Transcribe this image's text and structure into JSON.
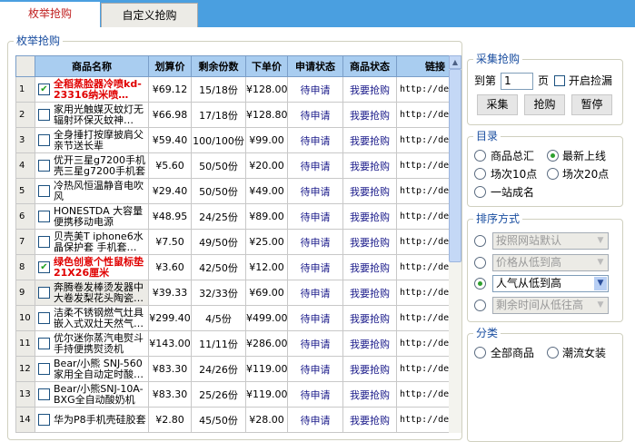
{
  "tabs": [
    {
      "label": "枚举抢购",
      "active": true
    },
    {
      "label": "自定义抢购",
      "active": false
    }
  ],
  "main_group": "枚举抢购",
  "table": {
    "headers": [
      "商品名称",
      "划算价",
      "剩余份数",
      "下单价",
      "申请状态",
      "商品状态",
      "链接"
    ],
    "rows": [
      {
        "n": "1",
        "checked": true,
        "red": true,
        "name": "全稻蒸脸器冷喷kd-23316纳米喷…",
        "price": "¥69.12",
        "remain": "15/18份",
        "order": "¥128.00",
        "apply": "待申请",
        "status": "我要抢购",
        "link": "http://de"
      },
      {
        "n": "2",
        "checked": false,
        "red": false,
        "name": "家用光触媒灭蚊灯无辐射环保灭蚊神…",
        "price": "¥66.98",
        "remain": "17/18份",
        "order": "¥128.80",
        "apply": "待申请",
        "status": "我要抢购",
        "link": "http://de"
      },
      {
        "n": "3",
        "checked": false,
        "red": false,
        "name": "全身捶打按摩披肩父亲节送长辈",
        "price": "¥59.40",
        "remain": "100/100份",
        "order": "¥99.00",
        "apply": "待申请",
        "status": "我要抢购",
        "link": "http://de"
      },
      {
        "n": "4",
        "checked": false,
        "red": false,
        "name": "优开三星g7200手机壳三星g7200手机套",
        "price": "¥5.60",
        "remain": "50/50份",
        "order": "¥20.00",
        "apply": "待申请",
        "status": "我要抢购",
        "link": "http://de"
      },
      {
        "n": "5",
        "checked": false,
        "red": false,
        "name": "冷热风恒温静音电吹风",
        "price": "¥29.40",
        "remain": "50/50份",
        "order": "¥49.00",
        "apply": "待申请",
        "status": "我要抢购",
        "link": "http://de"
      },
      {
        "n": "6",
        "checked": false,
        "red": false,
        "name": "HONESTDA 大容量便携移动电源",
        "price": "¥48.95",
        "remain": "24/25份",
        "order": "¥89.00",
        "apply": "待申请",
        "status": "我要抢购",
        "link": "http://de"
      },
      {
        "n": "7",
        "checked": false,
        "red": false,
        "name": "贝壳美T iphone6水晶保护套 手机套…",
        "price": "¥7.50",
        "remain": "49/50份",
        "order": "¥25.00",
        "apply": "待申请",
        "status": "我要抢购",
        "link": "http://de"
      },
      {
        "n": "8",
        "checked": true,
        "red": true,
        "name": "绿色创意个性鼠标垫21X26厘米",
        "price": "¥3.60",
        "remain": "42/50份",
        "order": "¥12.00",
        "apply": "待申请",
        "status": "我要抢购",
        "link": "http://de"
      },
      {
        "n": "9",
        "checked": false,
        "red": false,
        "name": "奔腾卷发棒烫发器中大卷发梨花头陶瓷…",
        "price": "¥39.33",
        "remain": "32/33份",
        "order": "¥69.00",
        "apply": "待申请",
        "status": "我要抢购",
        "link": "http://de"
      },
      {
        "n": "10",
        "checked": false,
        "red": false,
        "name": "洁柔不锈钢燃气灶具嵌入式双灶天然气…",
        "price": "¥299.40",
        "remain": "4/5份",
        "order": "¥499.00",
        "apply": "待申请",
        "status": "我要抢购",
        "link": "http://de"
      },
      {
        "n": "11",
        "checked": false,
        "red": false,
        "name": "优尔迷你蒸汽电熨斗手持便携熨烫机",
        "price": "¥143.00",
        "remain": "11/11份",
        "order": "¥286.00",
        "apply": "待申请",
        "status": "我要抢购",
        "link": "http://de"
      },
      {
        "n": "12",
        "checked": false,
        "red": false,
        "name": "Bear/小熊 SNJ-560家用全自动定时酸…",
        "price": "¥83.30",
        "remain": "24/26份",
        "order": "¥119.00",
        "apply": "待申请",
        "status": "我要抢购",
        "link": "http://de"
      },
      {
        "n": "13",
        "checked": false,
        "red": false,
        "name": "Bear/小熊SNJ-10A-BXG全自动酸奶机",
        "price": "¥83.30",
        "remain": "25/26份",
        "order": "¥119.00",
        "apply": "待申请",
        "status": "我要抢购",
        "link": "http://de"
      },
      {
        "n": "14",
        "checked": false,
        "red": false,
        "name": "华为P8手机壳硅胶套",
        "price": "¥2.80",
        "remain": "45/50份",
        "order": "¥28.00",
        "apply": "待申请",
        "status": "我要抢购",
        "link": "http://de"
      }
    ]
  },
  "collect": {
    "title": "采集抢购",
    "page_prefix": "到第",
    "page_value": "1",
    "page_suffix": "页",
    "leak_label": "开启捡漏",
    "buttons": [
      "采集",
      "抢购",
      "暂停"
    ]
  },
  "catalog": {
    "title": "目录",
    "options": [
      "商品总汇",
      "最新上线",
      "场次10点",
      "场次20点",
      "一站成名"
    ],
    "selected": 1
  },
  "sort": {
    "title": "排序方式",
    "options": [
      "按照网站默认",
      "价格从低到高",
      "人气从低到高",
      "剩余时间从低往高"
    ],
    "selected": 2
  },
  "category": {
    "title": "分类",
    "options": [
      "全部商品",
      "潮流女装"
    ]
  }
}
